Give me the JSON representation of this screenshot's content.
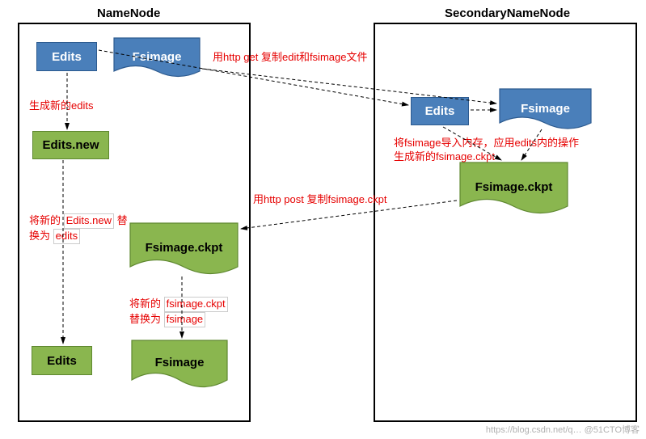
{
  "namenode": {
    "title": "NameNode",
    "edits1": "Edits",
    "fsimage1": "Fsimage",
    "edits_new": "Edits.new",
    "fsimage_ckpt": "Fsimage.ckpt",
    "edits2": "Edits",
    "fsimage2": "Fsimage"
  },
  "secondary": {
    "title": "SecondaryNameNode",
    "edits": "Edits",
    "fsimage": "Fsimage",
    "fsimage_ckpt": "Fsimage.ckpt"
  },
  "annotations": {
    "http_get": "用http get 复制edit和fsimage文件",
    "gen_new_edits": "生成新的edits",
    "apply_line1": "将fsimage导入内存，应用edits内的操作",
    "apply_line2": "生成新的fsimage.ckpt",
    "http_post": "用http post 复制fsimage.ckpt",
    "rename_edits_pre": "将新的",
    "rename_edits_tag": "Edits.new",
    "rename_edits_mid": "替",
    "rename_edits_mid2": "换为",
    "rename_edits_end": "edits",
    "rename_fs_pre": "将新的",
    "rename_fs_tag1": "fsimage.ckpt",
    "rename_fs_mid": "替换为",
    "rename_fs_tag2": "fsimage"
  },
  "watermark": "https://blog.csdn.net/q…  @51CTO博客"
}
